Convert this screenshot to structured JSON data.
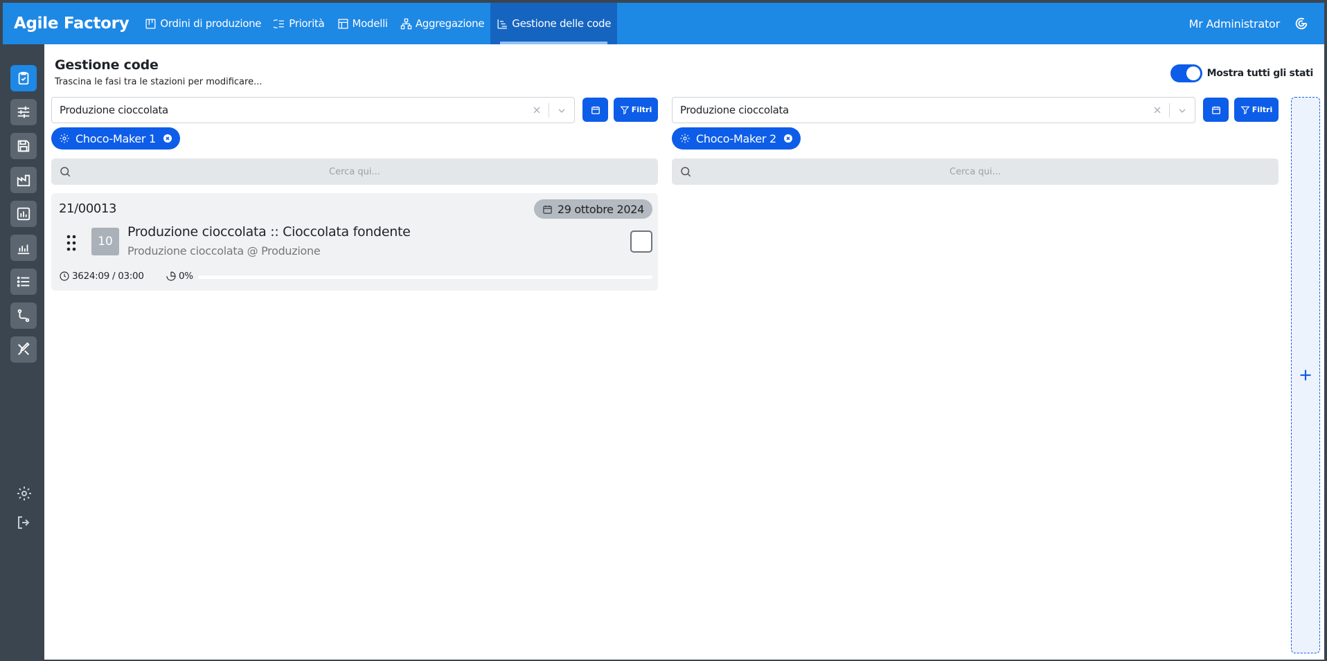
{
  "app": {
    "title": "Agile Factory"
  },
  "nav": [
    {
      "label": "Ordini di produzione",
      "icon": "kanban-icon"
    },
    {
      "label": "Priorità",
      "icon": "priority-list-icon"
    },
    {
      "label": "Modelli",
      "icon": "template-icon"
    },
    {
      "label": "Aggregazione",
      "icon": "sitemap-icon"
    },
    {
      "label": "Gestione delle code",
      "icon": "queue-icon",
      "active": true
    }
  ],
  "user": {
    "name": "Mr Administrator"
  },
  "page": {
    "title": "Gestione code",
    "subtitle": "Trascina le fasi tra le stazioni per modificare...",
    "toggle_label": "Mostra tutti gli stati",
    "toggle_on": true
  },
  "columns": [
    {
      "select_value": "Produzione cioccolata",
      "filter_label": "Filtri",
      "station": "Choco-Maker 1",
      "search_placeholder": "Cerca qui...",
      "cards": [
        {
          "code": "21/00013",
          "date": "29 ottobre 2024",
          "sequence": "10",
          "title": "Produzione cioccolata :: Cioccolata fondente",
          "subtitle": "Produzione cioccolata @ Produzione",
          "time": "3624:09 / 03:00",
          "progress": "0%"
        }
      ]
    },
    {
      "select_value": "Produzione cioccolata",
      "filter_label": "Filtri",
      "station": "Choco-Maker 2",
      "search_placeholder": "Cerca qui...",
      "cards": []
    }
  ],
  "colors": {
    "brand": "#1e88e5",
    "accent": "#0d5de8",
    "sidebar": "#3a4550"
  }
}
